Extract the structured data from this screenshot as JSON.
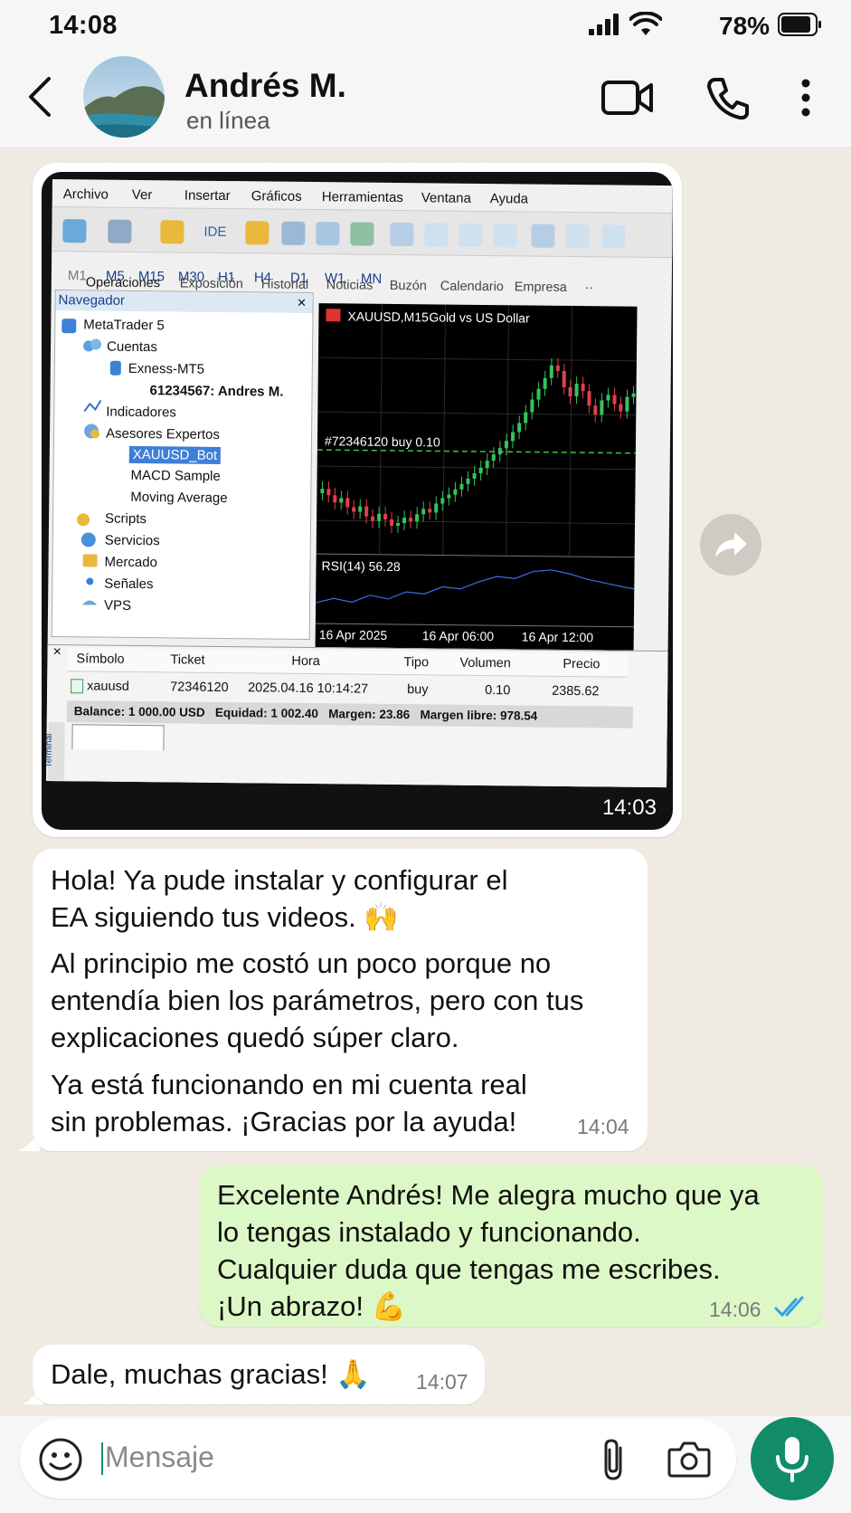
{
  "status_bar": {
    "time": "14:08",
    "battery": "78%"
  },
  "header": {
    "name": "Andrés M.",
    "status": "en línea"
  },
  "screenshot": {
    "menu": [
      "Archivo",
      "Ver",
      "Insertar",
      "Gráficos",
      "Herramientas",
      "Ventana",
      "Ayuda"
    ],
    "toolbar_ide": "IDE",
    "timeframes": [
      "M1",
      "M5",
      "M15",
      "M30",
      "H1",
      "H4",
      "D1",
      "W1",
      "MN"
    ],
    "navigator_title": "Navegador",
    "navigator_close": "×",
    "navigator": {
      "root": "MetaTrader 5",
      "accounts": "Cuentas",
      "server": "Exness-MT5",
      "account": "61234567: Andres M.",
      "indicators": "Indicadores",
      "experts": "Asesores Expertos",
      "ea1": "XAUUSD_Bot",
      "ea2": "MACD Sample",
      "ea3": "Moving Average",
      "scripts": "Scripts",
      "services": "Servicios",
      "market": "Mercado",
      "signals": "Señales",
      "vps": "VPS"
    },
    "chart_title": "XAUUSD,M15",
    "chart_subtitle": "Gold vs US Dollar",
    "order_line": "#72346120 buy 0.10",
    "rsi_label": "RSI(14) 56.28",
    "dates": [
      "16 Apr 2025",
      "16 Apr 06:00",
      "16 Apr 12:00"
    ],
    "table": {
      "close": "×",
      "headers": [
        "Símbolo",
        "Ticket",
        "Hora",
        "Tipo",
        "Volumen",
        "Precio"
      ],
      "row": [
        "xauusd",
        "72346120",
        "2025.04.16 10:14:27",
        "buy",
        "0.10",
        "2385.62"
      ],
      "balance": "Balance: 1 000.00 USD   Equidad: 1 002.40   Margen: 23.86   Margen libre: 978.54"
    },
    "tabs": [
      "Operaciones",
      "Exposición",
      "Historial",
      "Noticias",
      "Buzón",
      "Calendario",
      "Empresa"
    ],
    "tabs_more": "··",
    "side_label": "Terminal"
  },
  "messages": {
    "photo_time": "14:03",
    "m1_p1": "Hola! Ya pude instalar y configurar el EA siguiendo tus videos. 🙌",
    "m1_p2": "Al principio me costó un poco porque no entendía bien los parámetros, pero con tus explicaciones quedó súper claro.",
    "m1_p3": "Ya está funcionando en mi cuenta real sin problemas. ¡Gracias por la ayuda!",
    "m1_time": "14:04",
    "m2": "Excelente Andrés! Me alegra mucho que ya lo tengas instalado y funcionando. Cualquier duda que tengas me escribes. ¡Un abrazo! 💪",
    "m2_time": "14:06",
    "m3": "Dale, muchas gracias! 🙏",
    "m3_time": "14:07"
  },
  "input": {
    "placeholder": "Mensaje"
  },
  "colors": {
    "outgoing": "#dcf8c6",
    "mic": "#128c68",
    "read_ticks": "#34a0e8"
  }
}
